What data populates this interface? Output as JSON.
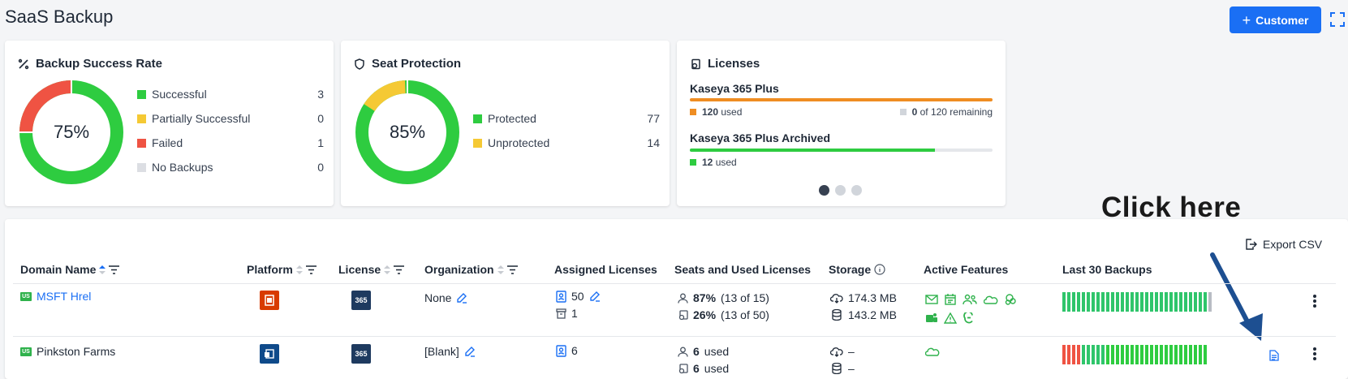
{
  "page": {
    "title": "SaaS Backup"
  },
  "header": {
    "customer_button": "Customer"
  },
  "cards": {
    "backup": {
      "title": "Backup Success Rate",
      "center": "75%",
      "legend": [
        {
          "label": "Successful",
          "value": "3",
          "color": "#2ecc40"
        },
        {
          "label": "Partially Successful",
          "value": "0",
          "color": "#f5c934"
        },
        {
          "label": "Failed",
          "value": "1",
          "color": "#ef5343"
        },
        {
          "label": "No Backups",
          "value": "0",
          "color": "#dcdee3"
        }
      ],
      "donut_fractions": [
        0.75,
        0.25
      ]
    },
    "seat": {
      "title": "Seat Protection",
      "center": "85%",
      "legend": [
        {
          "label": "Protected",
          "value": "77",
          "color": "#2ecc40"
        },
        {
          "label": "Unprotected",
          "value": "14",
          "color": "#f5c934"
        }
      ],
      "donut_fractions": [
        0.85,
        0.15
      ]
    },
    "licenses": {
      "title": "Licenses",
      "items": [
        {
          "name": "Kaseya 365 Plus",
          "used": "120",
          "used_suffix": "used",
          "remaining": "0",
          "remaining_suffix": "of 120 remaining",
          "fill_fraction": 1.0,
          "color": "#ef8d22"
        },
        {
          "name": "Kaseya 365 Plus Archived",
          "used": "12",
          "used_suffix": "used",
          "fill_fraction": 0.81,
          "color": "#2ecc40"
        }
      ],
      "page_dots": 3,
      "active_dot": 1
    }
  },
  "annotation": {
    "click_here": "Click here"
  },
  "table": {
    "export_label": "Export CSV",
    "columns": {
      "domain": "Domain Name",
      "platform": "Platform",
      "license": "License",
      "organization": "Organization",
      "assigned": "Assigned Licenses",
      "seats": "Seats and Used Licenses",
      "storage": "Storage",
      "features": "Active Features",
      "backups": "Last 30 Backups"
    },
    "rows": [
      {
        "region": "US",
        "domain": "MSFT Hrel",
        "license_badge": "365",
        "organization": "None",
        "assigned_count": "50",
        "archived_count": "1",
        "seats_pct": "87%",
        "seats_detail": "(13 of 15)",
        "used_pct": "26%",
        "used_detail": "(13 of 50)",
        "storage_backup": "174.3 MB",
        "storage_db": "143.2 MB"
      },
      {
        "region": "US",
        "domain": "Pinkston Farms",
        "license_badge": "365",
        "organization": "[Blank]",
        "assigned_count": "6",
        "seats_pct": "6",
        "seats_detail": "used",
        "used_pct": "6",
        "used_detail": "used",
        "storage_backup": "–",
        "storage_db": "–"
      }
    ]
  },
  "colors": {
    "accent": "#1a6ff4",
    "success": "#2ecc40",
    "fail": "#ef5343",
    "warning": "#f5c934"
  }
}
